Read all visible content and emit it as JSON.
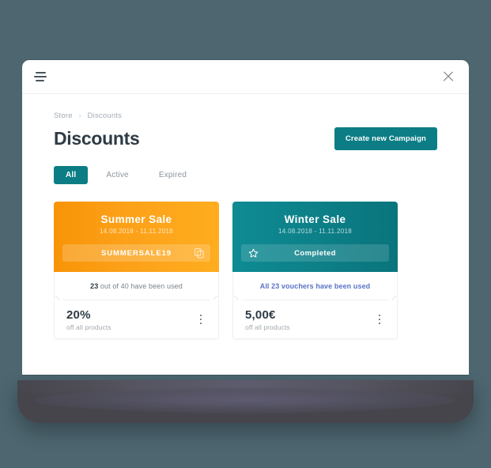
{
  "window": {
    "menu_icon": "hamburger-menu-icon",
    "close_icon": "close-icon"
  },
  "breadcrumb": {
    "items": [
      "Store",
      "Discounts"
    ],
    "separator": "›"
  },
  "header": {
    "title": "Discounts",
    "primary_button": "Create new Campaign"
  },
  "tabs": [
    {
      "label": "All",
      "active": true
    },
    {
      "label": "Active",
      "active": false
    },
    {
      "label": "Expired",
      "active": false
    }
  ],
  "colors": {
    "background": "#4d6670",
    "accent_teal": "#0c7d85",
    "orange_from": "#f89406",
    "orange_to": "#ffad1f",
    "teal_from": "#0e8b94",
    "teal_to": "#0a747c",
    "link_blue": "#5b72c8",
    "text_dark": "#2e3b45",
    "text_muted": "#a2aab0"
  },
  "cards": [
    {
      "title": "Summer  Sale",
      "dates": "14.08.2018 - 11.11.2018",
      "theme": "orange",
      "field_type": "code",
      "code": "SUMMERSALE19",
      "field_icon": "copy-icon",
      "usage_strong": "23",
      "usage_rest": " out of 40 have been used",
      "usage_is_link": false,
      "amount": "20%",
      "amount_sub": "off all products",
      "menu_icon": "kebab-menu-icon"
    },
    {
      "title": "Winter Sale",
      "dates": "14.08.2018 - 11.11.2018",
      "theme": "teal",
      "field_type": "status",
      "status": "Completed",
      "field_icon": "star-icon",
      "usage_strong": "",
      "usage_rest": "All 23 vouchers have been used",
      "usage_is_link": true,
      "amount": "5,00€",
      "amount_sub": "off all products",
      "menu_icon": "kebab-menu-icon"
    }
  ]
}
